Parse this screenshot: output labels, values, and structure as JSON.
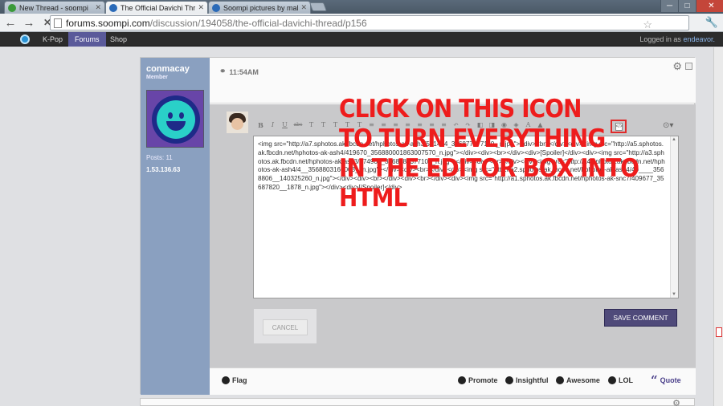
{
  "browser": {
    "tabs": [
      {
        "label": "New Thread - soompi",
        "favicon_color": "#3a9a3a"
      },
      {
        "label": "The Official Davichi Threac",
        "favicon_color": "#2a6ab8"
      },
      {
        "label": "Soompi pictures by maltwi",
        "favicon_color": "#2a6ab8"
      }
    ],
    "url_host": "forums.soompi.com",
    "url_path": "/discussion/194058/the-official-davichi-thread/p156",
    "back_icon": "←",
    "forward_icon": "→",
    "stop_icon": "✕",
    "star_icon": "☆",
    "wrench_icon": "🔧",
    "win_min": "─",
    "win_max": "□",
    "win_close": "✕"
  },
  "sitenav": {
    "items": [
      "K-Pop",
      "Forums",
      "Shop"
    ],
    "active": "Forums",
    "login_prefix": "Logged in as",
    "login_user": "endeavor."
  },
  "post": {
    "username": "conmacay",
    "role": "Member",
    "posts": "Posts: 11",
    "ip": "1.53.136.63",
    "time": "11:54AM",
    "editor_content": "<img src=\"http://a7.sphotos.ak.fbcdn.net/hphotos-ak-ash3/581474_356877377110 _n.jpg\"><div><br></div><div><img src=\"http://a5.sphotos.ak.fbcdn.net/hphotos-ak-ash4/419670_356880001863007570_n.jpg\"></div><div><br></div><div>[Spoiler]</div><div><img src=\"http://a3.sphotos.ak.fbcdn.net/hphotos-ak-ash3/574905_356878037710__n.jpg\"></div><div><br></div><div><img src=\"http://a4.sphotos.ak.fbcdn.net/hphotos-ak-ash4/4__3568803166003__n.jpg\"></div><div><br></div><div><img src=\"http://a2.sphotos.ak.fbcdn.net/hphotos-ak-ash4/40____3568806__140325260_n.jpg\"></div><div><br></div><div><br></div><div><img src=\"http://a1.sphotos.ak.fbcdn.net/hphotos-ak-snc7/409677_35687820__1878_n.jpg\"></div><div>[/Spoiler]</div>",
    "cancel_label": "CANCEL",
    "save_label": "SAVE COMMENT",
    "footer": {
      "flag": "Flag",
      "promote": "Promote",
      "insightful": "Insightful",
      "awesome": "Awesome",
      "lol": "LOL",
      "quote": "Quote",
      "quote_icon": "“"
    },
    "toolbar_icons": [
      "B",
      "I",
      "U",
      "abc",
      "T",
      "T",
      "T",
      "T",
      "T",
      "≡",
      "≡",
      "≡",
      "≡",
      "≡",
      "≡",
      "≡",
      "↶",
      "↷",
      "◧",
      "◨",
      "◉",
      "◈",
      "A",
      "▲"
    ],
    "html_icon_glyph": "</>",
    "options_icon": "⊙▾"
  },
  "annotation": {
    "lines": [
      "CLICK ON THIS ICON",
      "TO TURN EVERYTHING",
      "IN THE EDITOR BOX INTO",
      "HTML"
    ],
    "color": "#ee1c1c"
  },
  "colors": {
    "sidebar": "#8aa0c0",
    "save_button": "#4f4a7a",
    "site_active": "#5a5a9a"
  }
}
